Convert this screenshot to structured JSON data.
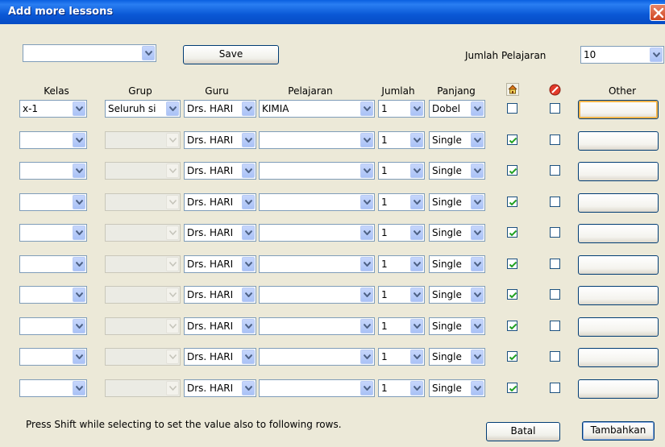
{
  "window": {
    "title": "Add more lessons"
  },
  "toolbar": {
    "top_select_value": "",
    "save_label": "Save",
    "count_label": "Jumlah Pelajaran",
    "count_value": "10"
  },
  "headers": {
    "kelas": "Kelas",
    "grup": "Grup",
    "guru": "Guru",
    "pelajaran": "Pelajaran",
    "jumlah": "Jumlah",
    "panjang": "Panjang",
    "other": "Other"
  },
  "icons": {
    "home_col": "home-icon",
    "forbidden_col": "forbidden-icon",
    "accent": "#0a58d6",
    "check_color": "#21a121"
  },
  "rows": [
    {
      "kelas": "x-1",
      "grup": "Seluruh si",
      "grup_enabled": true,
      "guru": "Drs. HARI",
      "pelajaran": "KIMIA",
      "jumlah": "1",
      "panjang": "Dobel",
      "home_checked": false,
      "forbidden_checked": false,
      "other": ""
    },
    {
      "kelas": "",
      "grup": "",
      "grup_enabled": false,
      "guru": "Drs. HARI",
      "pelajaran": "",
      "jumlah": "1",
      "panjang": "Single",
      "home_checked": true,
      "forbidden_checked": false,
      "other": ""
    },
    {
      "kelas": "",
      "grup": "",
      "grup_enabled": false,
      "guru": "Drs. HARI",
      "pelajaran": "",
      "jumlah": "1",
      "panjang": "Single",
      "home_checked": true,
      "forbidden_checked": false,
      "other": ""
    },
    {
      "kelas": "",
      "grup": "",
      "grup_enabled": false,
      "guru": "Drs. HARI",
      "pelajaran": "",
      "jumlah": "1",
      "panjang": "Single",
      "home_checked": true,
      "forbidden_checked": false,
      "other": ""
    },
    {
      "kelas": "",
      "grup": "",
      "grup_enabled": false,
      "guru": "Drs. HARI",
      "pelajaran": "",
      "jumlah": "1",
      "panjang": "Single",
      "home_checked": true,
      "forbidden_checked": false,
      "other": ""
    },
    {
      "kelas": "",
      "grup": "",
      "grup_enabled": false,
      "guru": "Drs. HARI",
      "pelajaran": "",
      "jumlah": "1",
      "panjang": "Single",
      "home_checked": true,
      "forbidden_checked": false,
      "other": ""
    },
    {
      "kelas": "",
      "grup": "",
      "grup_enabled": false,
      "guru": "Drs. HARI",
      "pelajaran": "",
      "jumlah": "1",
      "panjang": "Single",
      "home_checked": true,
      "forbidden_checked": false,
      "other": ""
    },
    {
      "kelas": "",
      "grup": "",
      "grup_enabled": false,
      "guru": "Drs. HARI",
      "pelajaran": "",
      "jumlah": "1",
      "panjang": "Single",
      "home_checked": true,
      "forbidden_checked": false,
      "other": ""
    },
    {
      "kelas": "",
      "grup": "",
      "grup_enabled": false,
      "guru": "Drs. HARI",
      "pelajaran": "",
      "jumlah": "1",
      "panjang": "Single",
      "home_checked": true,
      "forbidden_checked": false,
      "other": ""
    },
    {
      "kelas": "",
      "grup": "",
      "grup_enabled": false,
      "guru": "Drs. HARI",
      "pelajaran": "",
      "jumlah": "1",
      "panjang": "Single",
      "home_checked": true,
      "forbidden_checked": false,
      "other": ""
    }
  ],
  "footer": {
    "hint": "Press Shift while selecting to set the value also to following rows.",
    "cancel_label": "Batal",
    "add_label": "Tambahkan"
  }
}
